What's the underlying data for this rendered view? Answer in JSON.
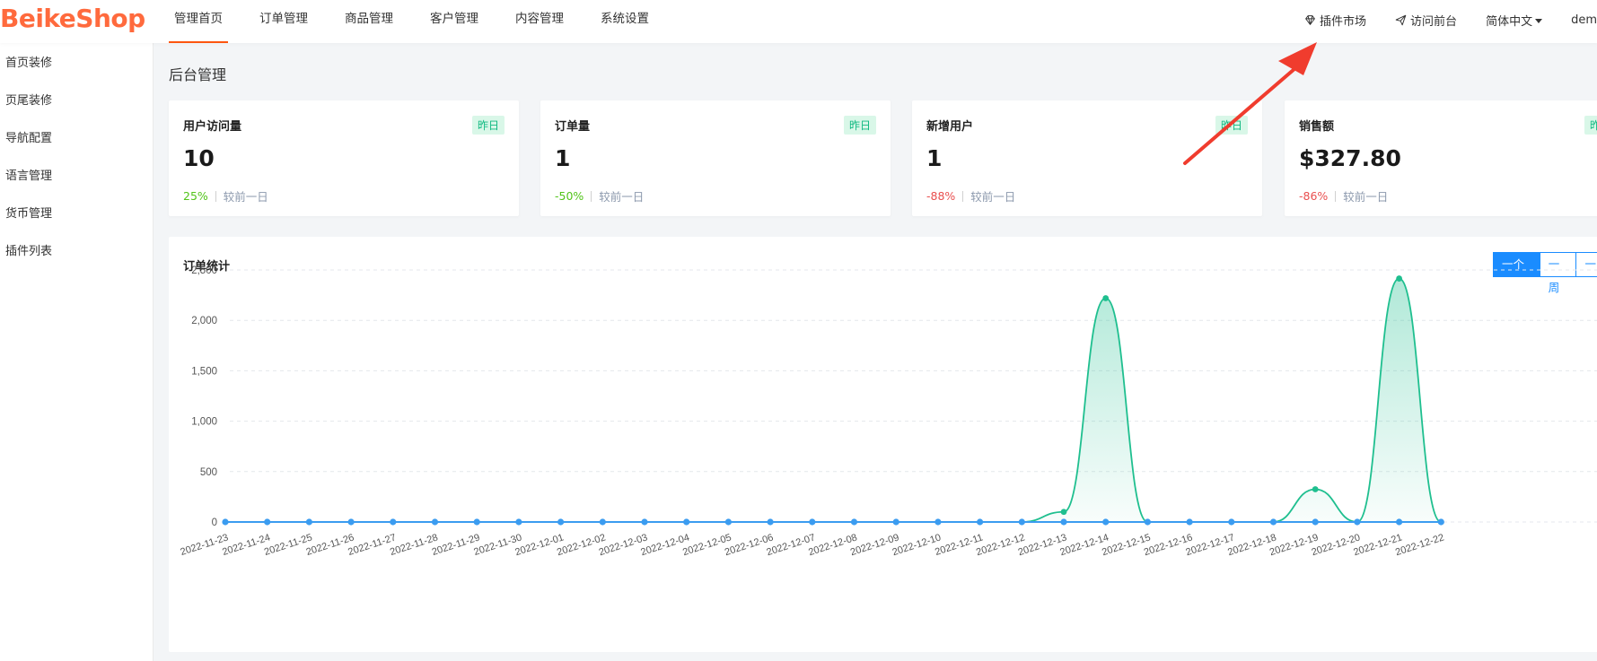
{
  "header": {
    "logo": "BeikeShop",
    "nav": [
      {
        "label": "管理首页",
        "active": true
      },
      {
        "label": "订单管理"
      },
      {
        "label": "商品管理"
      },
      {
        "label": "客户管理"
      },
      {
        "label": "内容管理"
      },
      {
        "label": "系统设置"
      }
    ],
    "plugin_market": "插件市场",
    "visit_front": "访问前台",
    "language": "简体中文",
    "user": "dem"
  },
  "sidebar": {
    "items": [
      "首页装修",
      "页尾装修",
      "导航配置",
      "语言管理",
      "货币管理",
      "插件列表"
    ]
  },
  "main": {
    "page_title": "后台管理",
    "cards": [
      {
        "label": "用户访问量",
        "badge": "昨日",
        "value": "10",
        "change": "25%",
        "compare": "较前一日"
      },
      {
        "label": "订单量",
        "badge": "昨日",
        "value": "1",
        "change": "-50%",
        "compare": "较前一日"
      },
      {
        "label": "新增用户",
        "badge": "昨日",
        "value": "1",
        "change": "-88%",
        "compare": "较前一日"
      },
      {
        "label": "销售额",
        "badge": "昨日",
        "value": "$327.80",
        "change": "-86%",
        "compare": "较前一日"
      }
    ],
    "chart_title": "订单统计",
    "ranges": [
      "一个月",
      "一周",
      "一"
    ]
  },
  "colors": {
    "brand": "#ff6a3d",
    "nav_active": "#fd560f",
    "badge_text": "#10b981",
    "badge_bg": "#d9f7e8",
    "positive": "#52c41a",
    "negative": "#e94f4f",
    "series_amount": "#1fbf8f",
    "series_orders": "#3b9cf0",
    "arrow": "#f03c2e"
  },
  "chart_data": {
    "type": "line",
    "x": [
      "2022-11-23",
      "2022-11-24",
      "2022-11-25",
      "2022-11-26",
      "2022-11-27",
      "2022-11-28",
      "2022-11-29",
      "2022-11-30",
      "2022-12-01",
      "2022-12-02",
      "2022-12-03",
      "2022-12-04",
      "2022-12-05",
      "2022-12-06",
      "2022-12-07",
      "2022-12-08",
      "2022-12-09",
      "2022-12-10",
      "2022-12-11",
      "2022-12-12",
      "2022-12-13",
      "2022-12-14",
      "2022-12-15",
      "2022-12-16",
      "2022-12-17",
      "2022-12-18",
      "2022-12-19",
      "2022-12-20",
      "2022-12-21",
      "2022-12-22"
    ],
    "series": [
      {
        "values": [
          0,
          0,
          0,
          0,
          0,
          0,
          0,
          0,
          0,
          0,
          0,
          0,
          0,
          0,
          0,
          0,
          0,
          0,
          0,
          0,
          100,
          2220,
          0,
          0,
          0,
          0,
          325,
          0,
          2415,
          0
        ]
      },
      {
        "values": [
          0,
          0,
          0,
          0,
          0,
          0,
          0,
          0,
          0,
          0,
          0,
          0,
          0,
          0,
          0,
          0,
          0,
          0,
          0,
          0,
          0,
          0,
          0,
          0,
          0,
          0,
          0,
          0,
          0,
          0
        ]
      }
    ],
    "y_ticks": [
      "0",
      "500",
      "1,000",
      "1,500",
      "2,000",
      "2,500"
    ],
    "ylim": [
      0,
      2500
    ],
    "grid": true,
    "smooth": true
  }
}
